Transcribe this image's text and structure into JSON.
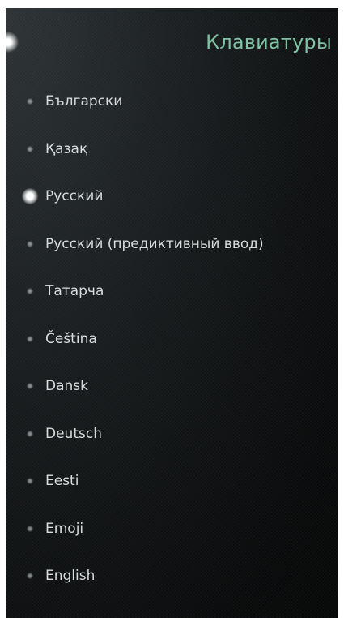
{
  "header": {
    "title": "Клавиатуры"
  },
  "keyboards": [
    {
      "label": "Български",
      "selected": false
    },
    {
      "label": "Қазақ",
      "selected": false
    },
    {
      "label": "Русский",
      "selected": true
    },
    {
      "label": "Русский (предиктивный ввод)",
      "selected": false
    },
    {
      "label": "Татарча",
      "selected": false
    },
    {
      "label": "Čeština",
      "selected": false
    },
    {
      "label": "Dansk",
      "selected": false
    },
    {
      "label": "Deutsch",
      "selected": false
    },
    {
      "label": "Eesti",
      "selected": false
    },
    {
      "label": "Emoji",
      "selected": false
    },
    {
      "label": "English",
      "selected": false
    }
  ],
  "colors": {
    "highlight": "#7fc2a4",
    "text": "#d8dcdc",
    "background": "#0a0b0c"
  }
}
